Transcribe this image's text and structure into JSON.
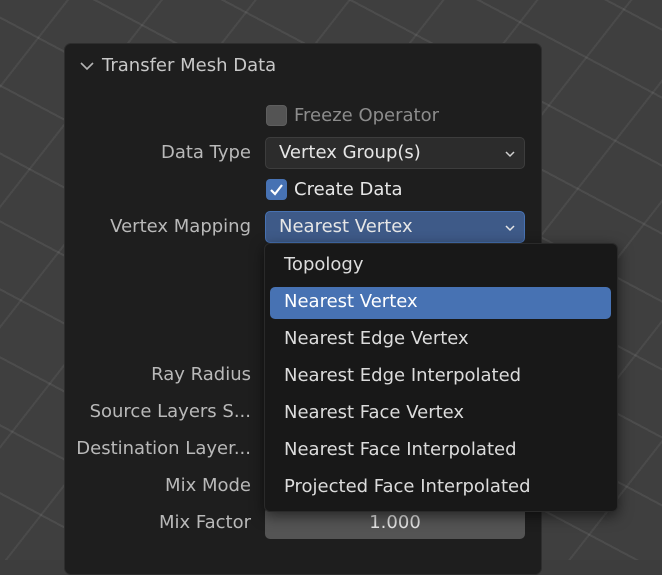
{
  "panel": {
    "title": "Transfer Mesh Data"
  },
  "freeze": {
    "label": "Freeze Operator",
    "checked": false
  },
  "data_type": {
    "label": "Data Type",
    "value": "Vertex Group(s)"
  },
  "create_data": {
    "label": "Create Data",
    "checked": true
  },
  "vertex_mapping": {
    "label": "Vertex Mapping",
    "value": "Nearest Vertex"
  },
  "ray_radius": {
    "label": "Ray Radius"
  },
  "source_layers": {
    "label": "Source Layers S..."
  },
  "destination_layers": {
    "label": "Destination Layer..."
  },
  "mix_mode": {
    "label": "Mix Mode"
  },
  "mix_factor": {
    "label": "Mix Factor",
    "value": "1.000"
  },
  "menu": {
    "items": [
      {
        "label": "Topology",
        "highlighted": false
      },
      {
        "label": "Nearest Vertex",
        "highlighted": true
      },
      {
        "label": "Nearest Edge Vertex",
        "highlighted": false
      },
      {
        "label": "Nearest Edge Interpolated",
        "highlighted": false
      },
      {
        "label": "Nearest Face Vertex",
        "highlighted": false
      },
      {
        "label": "Nearest Face Interpolated",
        "highlighted": false
      },
      {
        "label": "Projected Face Interpolated",
        "highlighted": false
      }
    ]
  },
  "colors": {
    "accent": "#4772b3",
    "panel_bg": "#1e1e1e",
    "menu_bg": "#181818",
    "viewport_bg": "#3f3f3f"
  },
  "icons": {
    "panel_toggle": "chevron-down-icon",
    "dropdown": "chevron-down-icon",
    "check": "checkmark-icon"
  }
}
